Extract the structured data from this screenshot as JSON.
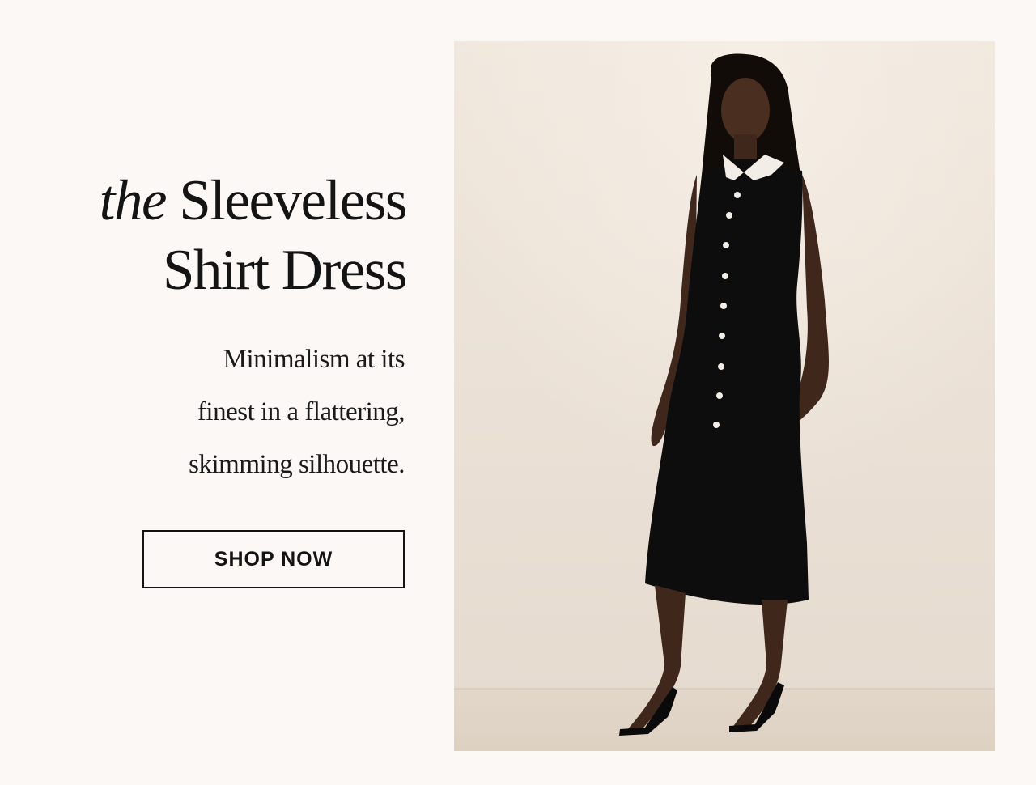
{
  "hero": {
    "headline_lead": "the",
    "headline_rest": "Sleeveless",
    "headline_line2": "Shirt Dress",
    "description_lines": [
      "Minimalism at its",
      "finest in a flattering,",
      "skimming silhouette."
    ],
    "cta_label": "SHOP NOW"
  },
  "image": {
    "subject": "model wearing black sleeveless shirt dress with white collar and buttons"
  },
  "colors": {
    "background": "#fbf8f5",
    "text": "#141414",
    "studio_wall": "#e8ded2",
    "dress": "#0d0d0d",
    "skin": "#4a2e20"
  }
}
